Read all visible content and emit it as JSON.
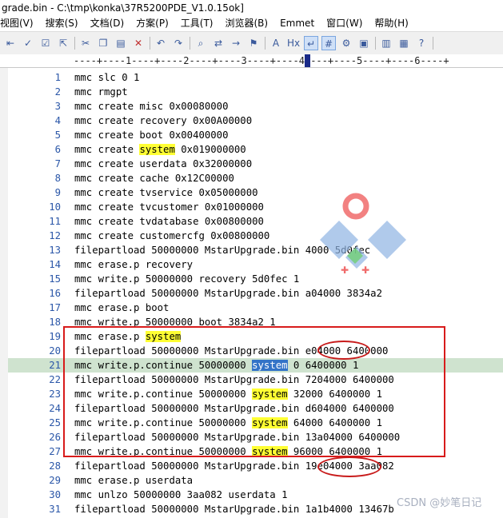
{
  "window": {
    "title": "grade.bin - C:\\tmp\\konka\\37R5200PDE_V1.0.15ok]"
  },
  "menu": [
    "视图(V)",
    "搜索(S)",
    "文档(D)",
    "方案(P)",
    "工具(T)",
    "浏览器(B)",
    "Emmet",
    "窗口(W)",
    "帮助(H)"
  ],
  "ruler": "----+----1----+----2----+----3----+----4----+----5----+----6----+",
  "toolbar_icons": [
    "indent-icon",
    "spellcheck-icon",
    "check-icon",
    "external-icon",
    "cut-icon",
    "copy-icon",
    "paste-icon",
    "delete-icon",
    "undo-icon",
    "redo-icon",
    "search-icon",
    "replace-icon",
    "goto-icon",
    "bookmark-icon",
    "font-icon",
    "hex-icon",
    "word-wrap-icon",
    "line-number-icon",
    "settings-icon",
    "window-icon",
    "tile-icon",
    "cascade-icon",
    "help-icon"
  ],
  "lines": [
    {
      "n": "1",
      "t": "mmc slc 0 1"
    },
    {
      "n": "2",
      "t": "mmc rmgpt"
    },
    {
      "n": "3",
      "t": "mmc create misc 0x00080000"
    },
    {
      "n": "4",
      "t": "mmc create recovery 0x00A00000"
    },
    {
      "n": "5",
      "t": "mmc create boot 0x00400000"
    },
    {
      "n": "6",
      "a": "mmc create ",
      "h": "system",
      "b": " 0x019000000"
    },
    {
      "n": "7",
      "t": "mmc create userdata 0x32000000"
    },
    {
      "n": "8",
      "t": "mmc create cache 0x12C00000"
    },
    {
      "n": "9",
      "t": "mmc create tvservice 0x05000000"
    },
    {
      "n": "10",
      "t": "mmc create tvcustomer 0x01000000"
    },
    {
      "n": "11",
      "t": "mmc create tvdatabase 0x00800000"
    },
    {
      "n": "12",
      "t": "mmc create customercfg 0x00800000"
    },
    {
      "n": "13",
      "t": "filepartload 50000000 MstarUpgrade.bin 4000 5d0fec"
    },
    {
      "n": "14",
      "t": "mmc erase.p recovery"
    },
    {
      "n": "15",
      "t": "mmc write.p 50000000 recovery 5d0fec 1"
    },
    {
      "n": "16",
      "t": "filepartload 50000000 MstarUpgrade.bin a04000 3834a2"
    },
    {
      "n": "17",
      "t": "mmc erase.p boot"
    },
    {
      "n": "18",
      "t": "mmc write.p 50000000 boot 3834a2 1"
    },
    {
      "n": "19",
      "a": "mmc erase.p ",
      "h": "system",
      "b": ""
    },
    {
      "n": "20",
      "t": "filepartload 50000000 MstarUpgrade.bin e04000 6400000"
    },
    {
      "n": "21",
      "a": "mmc write.p.continue 50000000 ",
      "s": "system",
      "b": " 0 6400000 1"
    },
    {
      "n": "22",
      "t": "filepartload 50000000 MstarUpgrade.bin 7204000 6400000"
    },
    {
      "n": "23",
      "a": "mmc write.p.continue 50000000 ",
      "h": "system",
      "b": " 32000 6400000 1"
    },
    {
      "n": "24",
      "t": "filepartload 50000000 MstarUpgrade.bin d604000 6400000"
    },
    {
      "n": "25",
      "a": "mmc write.p.continue 50000000 ",
      "h": "system",
      "b": " 64000 6400000 1"
    },
    {
      "n": "26",
      "t": "filepartload 50000000 MstarUpgrade.bin 13a04000 6400000"
    },
    {
      "n": "27",
      "a": "mmc write.p.continue 50000000 ",
      "h": "system",
      "b": " 96000 6400000 1"
    },
    {
      "n": "28",
      "t": "filepartload 50000000 MstarUpgrade.bin 19e04000 3aa082"
    },
    {
      "n": "29",
      "t": "mmc erase.p userdata"
    },
    {
      "n": "30",
      "t": "mmc unlzo 50000000 3aa082 userdata 1"
    },
    {
      "n": "31",
      "t": "filepartload 50000000 MstarUpgrade.bin 1a1b4000 13467b"
    }
  ],
  "current_line": "21",
  "watermark": "CSDN @妙笔日记",
  "colors": {
    "highlight": "#ffff33",
    "selection": "#3373c7",
    "current_line": "#cfe3cf",
    "annotation": "#d81b1b",
    "line_number": "#2b57a8"
  }
}
